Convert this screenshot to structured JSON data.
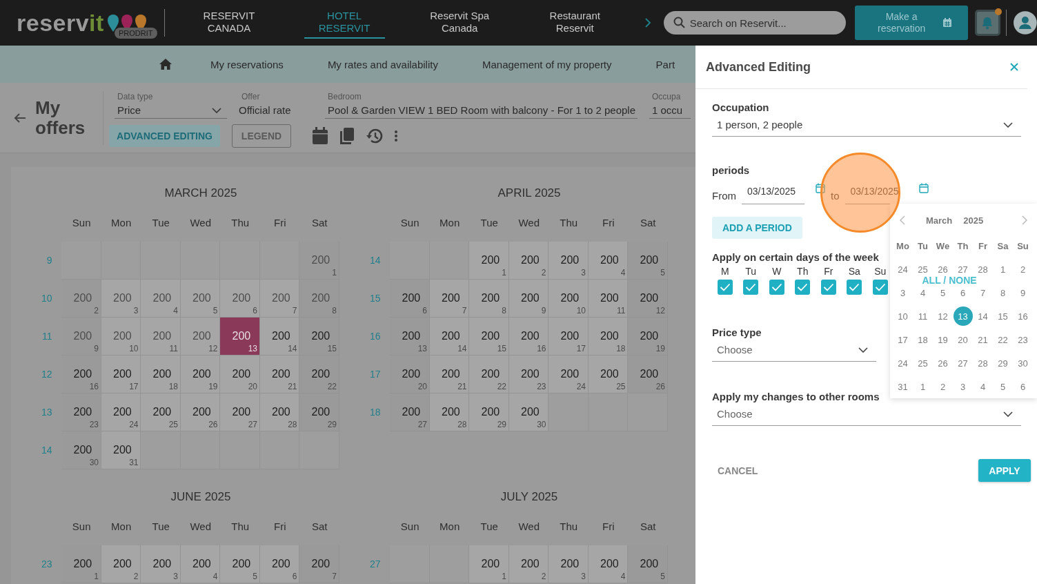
{
  "header": {
    "logo": {
      "main": "reserv",
      "accent": "it"
    },
    "badge": "PRODRIT",
    "brands": [
      {
        "label": "RESERVIT CANADA",
        "selected": false
      },
      {
        "label": "HOTEL RESERVIT",
        "selected": true
      },
      {
        "label": "Reservit Spa Canada",
        "selected": false
      },
      {
        "label": "Restaurant Reservit",
        "selected": false
      }
    ],
    "search": {
      "placeholder": "Search on Reservit..."
    },
    "reserve_button": "Make a reservation"
  },
  "nav": {
    "items": [
      "My reservations",
      "My rates and availability",
      "Management of my property",
      "Part"
    ]
  },
  "toolbar": {
    "title": "My offers",
    "fields": [
      {
        "label": "Data type",
        "value": "Price",
        "kind": "select"
      },
      {
        "label": "Offer",
        "value": "Official rate",
        "kind": "plain"
      },
      {
        "label": "Bedroom",
        "value": "Pool & Garden VIEW 1 BED Room with balcony - For 1 to 2 people",
        "kind": "select"
      },
      {
        "label": "Occupa",
        "value": "1 occu",
        "kind": "underlined"
      }
    ],
    "buttons": [
      {
        "label": "ADVANCED EDITING",
        "kind": "tonal"
      },
      {
        "label": "LEGEND",
        "kind": "outline"
      }
    ]
  },
  "calendars": [
    {
      "title": "MARCH 2025",
      "weekdays": [
        "Sun",
        "Mon",
        "Tue",
        "Wed",
        "Thu",
        "Fri",
        "Sat"
      ],
      "weeks": [
        {
          "number": "9",
          "days": [
            {
              "kind": "empty"
            },
            {
              "kind": "empty"
            },
            {
              "kind": "empty"
            },
            {
              "kind": "empty"
            },
            {
              "kind": "empty"
            },
            {
              "kind": "empty"
            },
            {
              "kind": "day",
              "price": "200",
              "day": "1",
              "past": true,
              "selected": false
            }
          ]
        },
        {
          "number": "10",
          "days": [
            {
              "kind": "day",
              "price": "200",
              "day": "2",
              "past": true,
              "selected": false
            },
            {
              "kind": "day",
              "price": "200",
              "day": "3",
              "past": true,
              "selected": false
            },
            {
              "kind": "day",
              "price": "200",
              "day": "4",
              "past": true,
              "selected": false
            },
            {
              "kind": "day",
              "price": "200",
              "day": "5",
              "past": true,
              "selected": false
            },
            {
              "kind": "day",
              "price": "200",
              "day": "6",
              "past": true,
              "selected": false
            },
            {
              "kind": "day",
              "price": "200",
              "day": "7",
              "past": true,
              "selected": false
            },
            {
              "kind": "day",
              "price": "200",
              "day": "8",
              "past": true,
              "selected": false
            }
          ]
        },
        {
          "number": "11",
          "days": [
            {
              "kind": "day",
              "price": "200",
              "day": "9",
              "past": true,
              "selected": false
            },
            {
              "kind": "day",
              "price": "200",
              "day": "10",
              "past": true,
              "selected": false
            },
            {
              "kind": "day",
              "price": "200",
              "day": "11",
              "past": true,
              "selected": false
            },
            {
              "kind": "day",
              "price": "200",
              "day": "12",
              "past": true,
              "selected": false
            },
            {
              "kind": "day",
              "price": "200",
              "day": "13",
              "past": false,
              "selected": true
            },
            {
              "kind": "day",
              "price": "200",
              "day": "14",
              "past": false,
              "selected": false
            },
            {
              "kind": "day",
              "price": "200",
              "day": "15",
              "past": false,
              "selected": false
            }
          ]
        },
        {
          "number": "12",
          "days": [
            {
              "kind": "day",
              "price": "200",
              "day": "16",
              "past": false,
              "selected": false
            },
            {
              "kind": "day",
              "price": "200",
              "day": "17",
              "past": false,
              "selected": false
            },
            {
              "kind": "day",
              "price": "200",
              "day": "18",
              "past": false,
              "selected": false
            },
            {
              "kind": "day",
              "price": "200",
              "day": "19",
              "past": false,
              "selected": false
            },
            {
              "kind": "day",
              "price": "200",
              "day": "20",
              "past": false,
              "selected": false
            },
            {
              "kind": "day",
              "price": "200",
              "day": "21",
              "past": false,
              "selected": false
            },
            {
              "kind": "day",
              "price": "200",
              "day": "22",
              "past": false,
              "selected": false
            }
          ]
        },
        {
          "number": "13",
          "days": [
            {
              "kind": "day",
              "price": "200",
              "day": "23",
              "past": false,
              "selected": false
            },
            {
              "kind": "day",
              "price": "200",
              "day": "24",
              "past": false,
              "selected": false
            },
            {
              "kind": "day",
              "price": "200",
              "day": "25",
              "past": false,
              "selected": false
            },
            {
              "kind": "day",
              "price": "200",
              "day": "26",
              "past": false,
              "selected": false
            },
            {
              "kind": "day",
              "price": "200",
              "day": "27",
              "past": false,
              "selected": false
            },
            {
              "kind": "day",
              "price": "200",
              "day": "28",
              "past": false,
              "selected": false
            },
            {
              "kind": "day",
              "price": "200",
              "day": "29",
              "past": false,
              "selected": false
            }
          ]
        },
        {
          "number": "14",
          "days": [
            {
              "kind": "day",
              "price": "200",
              "day": "30",
              "past": false,
              "selected": false
            },
            {
              "kind": "day",
              "price": "200",
              "day": "31",
              "past": false,
              "selected": false
            },
            {
              "kind": "empty"
            },
            {
              "kind": "empty"
            },
            {
              "kind": "empty"
            },
            {
              "kind": "empty"
            },
            {
              "kind": "empty"
            }
          ]
        }
      ]
    },
    {
      "title": "APRIL 2025",
      "weekdays": [
        "Sun",
        "Mon",
        "Tue",
        "Wed",
        "Thu",
        "Fri",
        "Sat"
      ],
      "weeks": [
        {
          "number": "14",
          "days": [
            {
              "kind": "empty"
            },
            {
              "kind": "empty"
            },
            {
              "kind": "day",
              "price": "200",
              "day": "1",
              "past": false,
              "selected": false
            },
            {
              "kind": "day",
              "price": "200",
              "day": "2",
              "past": false,
              "selected": false
            },
            {
              "kind": "day",
              "price": "200",
              "day": "3",
              "past": false,
              "selected": false
            },
            {
              "kind": "day",
              "price": "200",
              "day": "4",
              "past": false,
              "selected": false
            },
            {
              "kind": "day",
              "price": "200",
              "day": "5",
              "past": false,
              "selected": false
            }
          ]
        },
        {
          "number": "15",
          "days": [
            {
              "kind": "day",
              "price": "200",
              "day": "6",
              "past": false,
              "selected": false
            },
            {
              "kind": "day",
              "price": "200",
              "day": "7",
              "past": false,
              "selected": false
            },
            {
              "kind": "day",
              "price": "200",
              "day": "8",
              "past": false,
              "selected": false
            },
            {
              "kind": "day",
              "price": "200",
              "day": "9",
              "past": false,
              "selected": false
            },
            {
              "kind": "day",
              "price": "200",
              "day": "10",
              "past": false,
              "selected": false
            },
            {
              "kind": "day",
              "price": "200",
              "day": "11",
              "past": false,
              "selected": false
            },
            {
              "kind": "day",
              "price": "200",
              "day": "12",
              "past": false,
              "selected": false
            }
          ]
        },
        {
          "number": "16",
          "days": [
            {
              "kind": "day",
              "price": "200",
              "day": "13",
              "past": false,
              "selected": false
            },
            {
              "kind": "day",
              "price": "200",
              "day": "14",
              "past": false,
              "selected": false
            },
            {
              "kind": "day",
              "price": "200",
              "day": "15",
              "past": false,
              "selected": false
            },
            {
              "kind": "day",
              "price": "200",
              "day": "16",
              "past": false,
              "selected": false
            },
            {
              "kind": "day",
              "price": "200",
              "day": "17",
              "past": false,
              "selected": false
            },
            {
              "kind": "day",
              "price": "200",
              "day": "18",
              "past": false,
              "selected": false
            },
            {
              "kind": "day",
              "price": "200",
              "day": "19",
              "past": false,
              "selected": false
            }
          ]
        },
        {
          "number": "17",
          "days": [
            {
              "kind": "day",
              "price": "200",
              "day": "20",
              "past": false,
              "selected": false
            },
            {
              "kind": "day",
              "price": "200",
              "day": "21",
              "past": false,
              "selected": false
            },
            {
              "kind": "day",
              "price": "200",
              "day": "22",
              "past": false,
              "selected": false
            },
            {
              "kind": "day",
              "price": "200",
              "day": "23",
              "past": false,
              "selected": false
            },
            {
              "kind": "day",
              "price": "200",
              "day": "24",
              "past": false,
              "selected": false
            },
            {
              "kind": "day",
              "price": "200",
              "day": "25",
              "past": false,
              "selected": false
            },
            {
              "kind": "day",
              "price": "200",
              "day": "26",
              "past": false,
              "selected": false
            }
          ]
        },
        {
          "number": "18",
          "days": [
            {
              "kind": "day",
              "price": "200",
              "day": "27",
              "past": false,
              "selected": false
            },
            {
              "kind": "day",
              "price": "200",
              "day": "28",
              "past": false,
              "selected": false
            },
            {
              "kind": "day",
              "price": "200",
              "day": "29",
              "past": false,
              "selected": false
            },
            {
              "kind": "day",
              "price": "200",
              "day": "30",
              "past": false,
              "selected": false
            },
            {
              "kind": "empty"
            },
            {
              "kind": "empty"
            },
            {
              "kind": "empty"
            }
          ]
        }
      ]
    },
    {
      "title": "JUNE 2025",
      "weekdays": [
        "Sun",
        "Mon",
        "Tue",
        "Wed",
        "Thu",
        "Fri",
        "Sat"
      ],
      "weeks": [
        {
          "number": "23",
          "days": [
            {
              "kind": "day",
              "price": "200",
              "day": "1",
              "past": false,
              "selected": false
            },
            {
              "kind": "day",
              "price": "200",
              "day": "2",
              "past": false,
              "selected": false
            },
            {
              "kind": "day",
              "price": "200",
              "day": "3",
              "past": false,
              "selected": false
            },
            {
              "kind": "day",
              "price": "200",
              "day": "4",
              "past": false,
              "selected": false
            },
            {
              "kind": "day",
              "price": "200",
              "day": "5",
              "past": false,
              "selected": false
            },
            {
              "kind": "day",
              "price": "200",
              "day": "6",
              "past": false,
              "selected": false
            },
            {
              "kind": "day",
              "price": "200",
              "day": "7",
              "past": false,
              "selected": false
            }
          ]
        }
      ]
    },
    {
      "title": "JULY 2025",
      "weekdays": [
        "Sun",
        "Mon",
        "Tue",
        "Wed",
        "Thu",
        "Fri",
        "Sat"
      ],
      "weeks": [
        {
          "number": "27",
          "days": [
            {
              "kind": "empty"
            },
            {
              "kind": "empty"
            },
            {
              "kind": "day",
              "price": "200",
              "day": "1",
              "past": false,
              "selected": false
            },
            {
              "kind": "day",
              "price": "200",
              "day": "2",
              "past": false,
              "selected": false
            },
            {
              "kind": "day",
              "price": "200",
              "day": "3",
              "past": false,
              "selected": false
            },
            {
              "kind": "day",
              "price": "200",
              "day": "4",
              "past": false,
              "selected": false
            },
            {
              "kind": "day",
              "price": "200",
              "day": "5",
              "past": false,
              "selected": false
            }
          ]
        }
      ]
    }
  ],
  "panel": {
    "title": "Advanced Editing",
    "occupation": {
      "label": "Occupation",
      "value": "1 person, 2 people"
    },
    "periods": {
      "label": "periods",
      "from_label": "From",
      "from": "03/13/2025",
      "to_label": "to",
      "to": "03/13/2025",
      "add_button": "ADD A PERIOD"
    },
    "days_title": "Apply on certain days of the week",
    "weekdays": [
      {
        "label": "M",
        "checked": true
      },
      {
        "label": "Tu",
        "checked": true
      },
      {
        "label": "W",
        "checked": true
      },
      {
        "label": "Th",
        "checked": true
      },
      {
        "label": "Fr",
        "checked": true
      },
      {
        "label": "Sa",
        "checked": true
      },
      {
        "label": "Su",
        "checked": true
      }
    ],
    "all_none": "ALL / NONE",
    "price_type": {
      "label": "Price type",
      "placeholder": "Choose"
    },
    "other_rooms": {
      "label": "Apply my changes to other rooms",
      "placeholder": "Choose"
    },
    "cancel": "CANCEL",
    "apply": "APPLY",
    "picker": {
      "month": "March",
      "year": "2025",
      "weekdays": [
        "Mo",
        "Tu",
        "We",
        "Th",
        "Fr",
        "Sa",
        "Su"
      ],
      "days": [
        {
          "day": "24",
          "selected": false
        },
        {
          "day": "25",
          "selected": false
        },
        {
          "day": "26",
          "selected": false
        },
        {
          "day": "27",
          "selected": false
        },
        {
          "day": "28",
          "selected": false
        },
        {
          "day": "1",
          "selected": false
        },
        {
          "day": "2",
          "selected": false
        },
        {
          "day": "3",
          "selected": false
        },
        {
          "day": "4",
          "selected": false
        },
        {
          "day": "5",
          "selected": false
        },
        {
          "day": "6",
          "selected": false
        },
        {
          "day": "7",
          "selected": false
        },
        {
          "day": "8",
          "selected": false
        },
        {
          "day": "9",
          "selected": false
        },
        {
          "day": "10",
          "selected": false
        },
        {
          "day": "11",
          "selected": false
        },
        {
          "day": "12",
          "selected": false
        },
        {
          "day": "13",
          "selected": true
        },
        {
          "day": "14",
          "selected": false
        },
        {
          "day": "15",
          "selected": false
        },
        {
          "day": "16",
          "selected": false
        },
        {
          "day": "17",
          "selected": false
        },
        {
          "day": "18",
          "selected": false
        },
        {
          "day": "19",
          "selected": false
        },
        {
          "day": "20",
          "selected": false
        },
        {
          "day": "21",
          "selected": false
        },
        {
          "day": "22",
          "selected": false
        },
        {
          "day": "23",
          "selected": false
        },
        {
          "day": "24",
          "selected": false
        },
        {
          "day": "25",
          "selected": false
        },
        {
          "day": "26",
          "selected": false
        },
        {
          "day": "27",
          "selected": false
        },
        {
          "day": "28",
          "selected": false
        },
        {
          "day": "29",
          "selected": false
        },
        {
          "day": "30",
          "selected": false
        },
        {
          "day": "31",
          "selected": false
        },
        {
          "day": "1",
          "selected": false
        },
        {
          "day": "2",
          "selected": false
        },
        {
          "day": "3",
          "selected": false
        },
        {
          "day": "4",
          "selected": false
        },
        {
          "day": "5",
          "selected": false
        },
        {
          "day": "6",
          "selected": false
        }
      ]
    }
  }
}
